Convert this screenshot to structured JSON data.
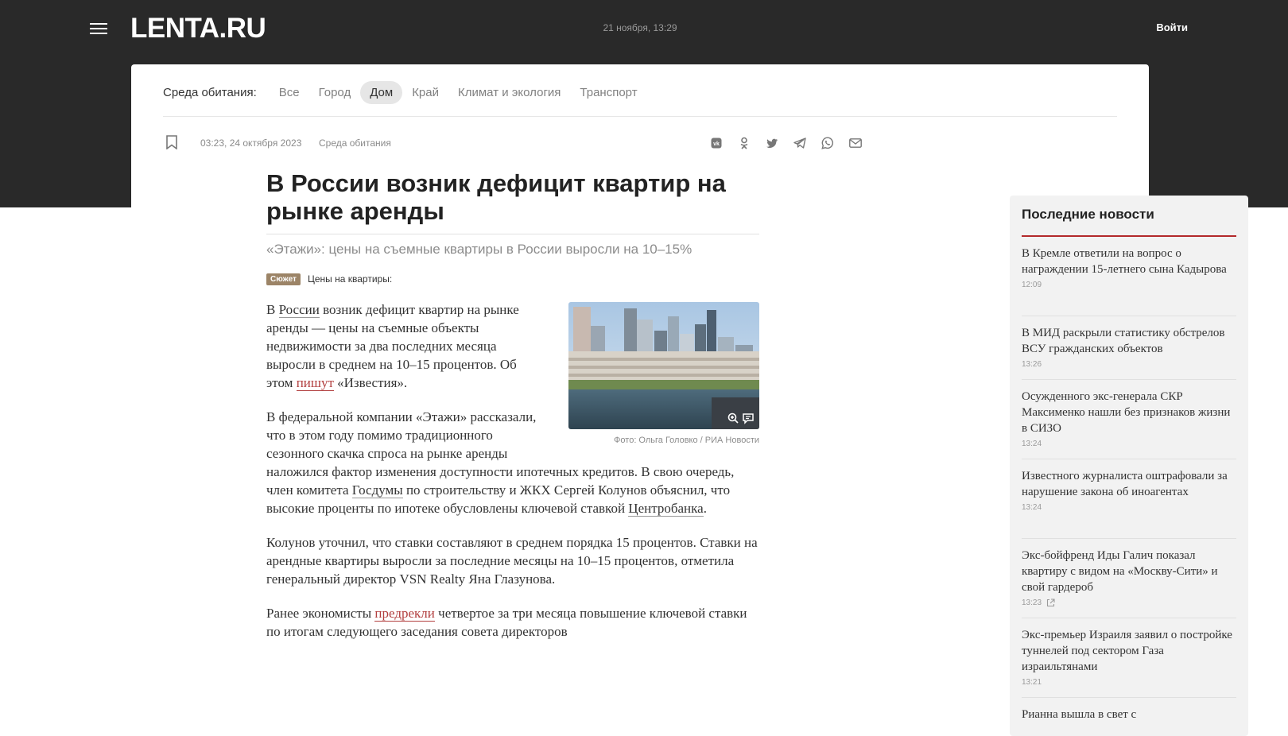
{
  "header": {
    "logo": "LENTA.RU",
    "datetime": "21 ноября, 13:29",
    "login": "Войти"
  },
  "subnav": {
    "label": "Среда обитания:",
    "items": [
      "Все",
      "Город",
      "Дом",
      "Край",
      "Климат и экология",
      "Транспорт"
    ],
    "active": "Дом"
  },
  "article": {
    "date": "03:23, 24 октября 2023",
    "rubric": "Среда обитания",
    "title": "В России возник дефицит квартир на рынке аренды",
    "lead": "«Этажи»: цены на съемные квартиры в России выросли на 10–15%",
    "story_badge": "Сюжет",
    "story_title": "Цены на квартиры:",
    "photo_caption": "Фото: Ольга Головко / РИА Новости",
    "p1": {
      "a": "В ",
      "link1": "России",
      "b": " возник дефицит квартир на рынке аренды — цены на съемные объекты недвижимости за два последних месяца выросли в среднем на 10–15 процентов. Об этом ",
      "link2": "пишут",
      "c": " «Известия»."
    },
    "p2": {
      "a": "В федеральной компании «Этажи» рассказали, что в этом году помимо традиционного сезонного скачка спроса на рынке аренды наложился фактор изменения доступности ипотечных кредитов. В свою очередь, член комитета ",
      "link1": "Госдумы",
      "b": " по строительству и ЖКХ Сергей Колунов объяснил, что высокие проценты по ипотеке обусловлены ключевой ставкой ",
      "link2": "Центробанка",
      "c": "."
    },
    "p3": "Колунов уточнил, что ставки составляют в среднем порядка 15 процентов. Ставки на арендные квартиры выросли за последние месяцы на 10–15 процентов, отметила генеральный директор VSN Realty Яна Глазунова.",
    "p4": {
      "a": "Ранее экономисты ",
      "link1": "предрекли",
      "b": " четвертое за три месяца повышение ключевой ставки по итогам следующего заседания совета директоров"
    }
  },
  "share_icons": [
    "vk-icon",
    "ok-icon",
    "twitter-icon",
    "telegram-icon",
    "whatsapp-icon",
    "mail-icon"
  ],
  "sidebar": {
    "title": "Последние новости",
    "news": [
      {
        "title": "В Кремле ответили на вопрос о награждении 15-летнего сына Кадырова",
        "time": "12:09"
      },
      {
        "title": "В МИД раскрыли статистику обстрелов ВСУ гражданских объектов",
        "time": "13:26"
      },
      {
        "title": "Осужденного экс-генерала СКР Максименко нашли без признаков жизни в СИЗО",
        "time": "13:24"
      },
      {
        "title": "Известного журналиста оштрафовали за нарушение закона об иноагентах",
        "time": "13:24"
      },
      {
        "title": "Экс-бойфренд Иды Галич показал квартиру с видом на «Москву-Сити» и свой гардероб",
        "time": "13:23"
      },
      {
        "title": "Экс-премьер Израиля заявил о постройке туннелей под сектором Газа израильтянами",
        "time": "13:21"
      },
      {
        "title": "Рианна вышла в свет с",
        "time": ""
      }
    ]
  },
  "colors": {
    "header_bg": "#292929",
    "accent_red": "#b3292b",
    "link_red": "#b23f3f",
    "story_badge": "#9c8467"
  }
}
